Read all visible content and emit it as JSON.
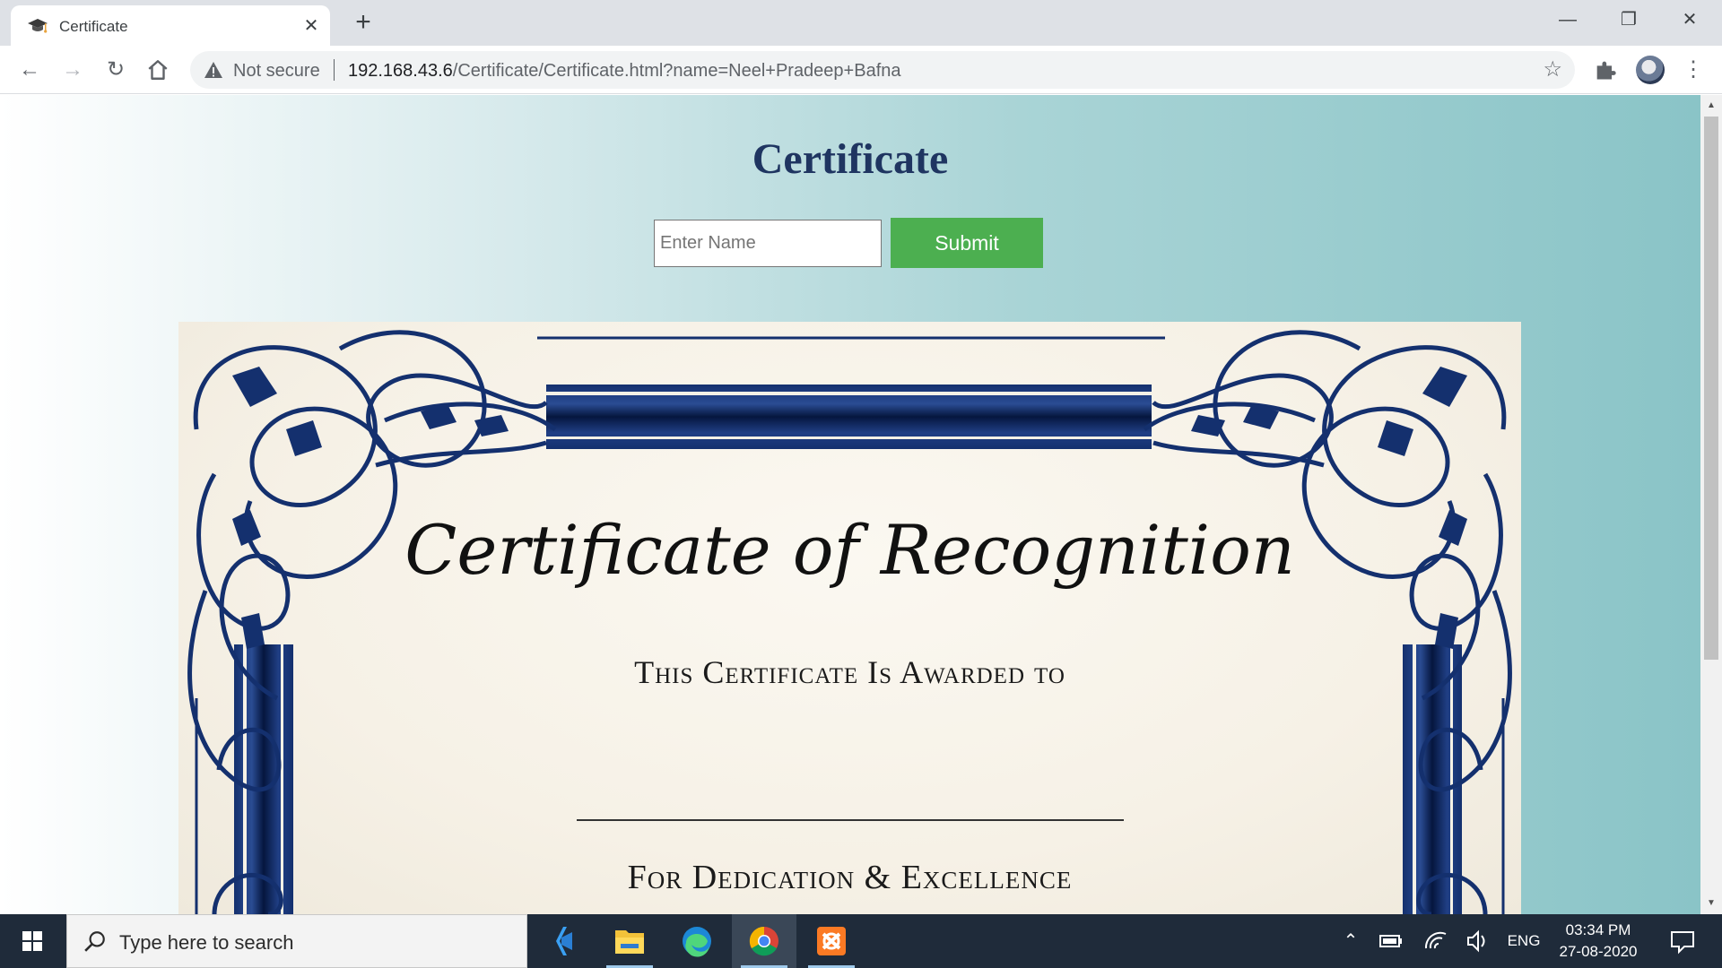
{
  "browser": {
    "tab_title": "Certificate",
    "tab_close": "✕",
    "new_tab": "+",
    "window": {
      "minimize": "—",
      "restore": "❐",
      "close": "✕"
    },
    "security_label": "Not secure",
    "url_host": "192.168.43.6",
    "url_path": "/Certificate/Certificate.html?name=Neel+Pradeep+Bafna"
  },
  "page": {
    "heading": "Certificate",
    "name_placeholder": "Enter Name",
    "submit_label": "Submit",
    "accent_color": "#4caf50"
  },
  "certificate": {
    "title": "Certificate of Recognition",
    "subtitle": "This Certificate Is Awarded to",
    "footer": "For Dedication & Excellence",
    "border_color": "#14306e"
  },
  "taskbar": {
    "search_placeholder": "Type here to search",
    "language": "ENG",
    "time": "03:34 PM",
    "date": "27-08-2020",
    "apps": [
      "vscode-icon",
      "file-explorer-icon",
      "edge-icon",
      "chrome-icon",
      "xampp-icon"
    ]
  }
}
